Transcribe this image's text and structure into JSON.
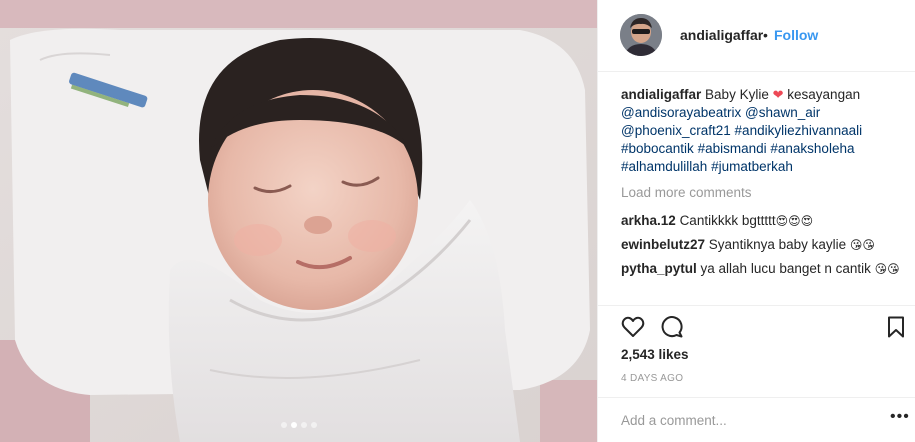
{
  "photo": {
    "alt_icon": "newborn-photo",
    "carousel": {
      "count": 4,
      "active_index": 1
    }
  },
  "header": {
    "username": "andialigaffar",
    "separator": "•",
    "follow_label": "Follow"
  },
  "caption": {
    "username": "andialigaffar",
    "text_before": "Baby Kylie",
    "heart": "❤",
    "text_after": "kesayangan",
    "tags": [
      "@andisorayabeatrix",
      "@shawn_air",
      "@phoenix_craft21",
      "#andikyliezhivannaali",
      "#bobocantik",
      "#abismandi",
      "#anaksholeha",
      "#alhamdulillah",
      "#jumatberkah"
    ]
  },
  "load_more_label": "Load more comments",
  "comments": [
    {
      "username": "arkha.12",
      "text": "Cantikkkk bgttttt",
      "emoji": "😍😍😍"
    },
    {
      "username": "ewinbelutz27",
      "text": "Syantiknya baby kaylie",
      "emoji": "😘😘"
    },
    {
      "username": "pytha_pytul",
      "text": "ya allah lucu banget n cantik",
      "emoji": "😘😘"
    }
  ],
  "actions": {
    "like_icon": "heart-outline-icon",
    "comment_icon": "comment-bubble-icon",
    "save_icon": "bookmark-icon"
  },
  "likes": "2,543 likes",
  "timestamp": "4 DAYS AGO",
  "add_comment": {
    "placeholder": "Add a comment...",
    "more_label": "•••"
  },
  "colors": {
    "link": "#3897f0",
    "tag": "#003569",
    "muted": "#999999",
    "heart": "#ed4956"
  }
}
